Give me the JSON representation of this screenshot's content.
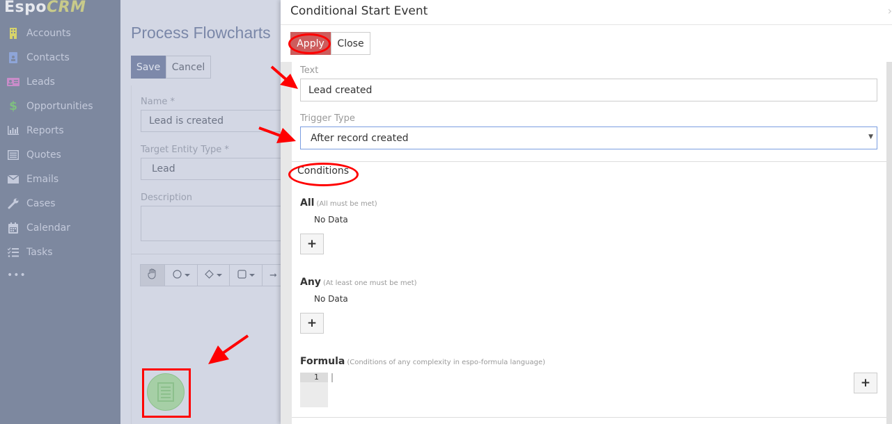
{
  "app": {
    "logo_main": "Espo",
    "logo_accent": "CRM"
  },
  "sidebar": {
    "items": [
      {
        "label": "Accounts",
        "icon": "building-icon",
        "color": "#d7d36a"
      },
      {
        "label": "Contacts",
        "icon": "id-badge-icon",
        "color": "#8ea5d8"
      },
      {
        "label": "Leads",
        "icon": "address-card-icon",
        "color": "#c98cc9"
      },
      {
        "label": "Opportunities",
        "icon": "dollar-icon",
        "color": "#7fbf7f"
      },
      {
        "label": "Reports",
        "icon": "bar-chart-icon",
        "color": "#c4cadb"
      },
      {
        "label": "Quotes",
        "icon": "list-alt-icon",
        "color": "#c4cadb"
      },
      {
        "label": "Emails",
        "icon": "envelope-icon",
        "color": "#c4cadb"
      },
      {
        "label": "Cases",
        "icon": "wrench-icon",
        "color": "#c4cadb"
      },
      {
        "label": "Calendar",
        "icon": "calendar-icon",
        "color": "#c4cadb"
      },
      {
        "label": "Tasks",
        "icon": "tasks-icon",
        "color": "#c4cadb"
      }
    ],
    "more": "•••"
  },
  "main": {
    "title": "Process Flowcharts",
    "save_label": "Save",
    "cancel_label": "Cancel",
    "fields": {
      "name_label": "Name *",
      "name_value": "Lead is created",
      "target_label": "Target Entity Type *",
      "target_value": "Lead",
      "description_label": "Description",
      "description_value": ""
    },
    "toolbar": [
      "hand-tool",
      "event-tool",
      "gateway-tool",
      "task-tool",
      "flow-tool"
    ]
  },
  "dialog": {
    "title": "Conditional Start Event",
    "apply_label": "Apply",
    "close_label": "Close",
    "text_label": "Text",
    "text_value": "Lead created",
    "trigger_label": "Trigger Type",
    "trigger_value": "After record created",
    "conditions_title": "Conditions",
    "all": {
      "title": "All",
      "hint": "(All must be met)",
      "empty": "No Data"
    },
    "any": {
      "title": "Any",
      "hint": "(At least one must be met)",
      "empty": "No Data"
    },
    "formula": {
      "title": "Formula",
      "hint": "(Conditions of any complexity in espo-formula language)",
      "line_number": "1"
    },
    "add_symbol": "+"
  },
  "colors": {
    "apply": "#cd5c5c",
    "annotation": "#ff0000",
    "sidebar_bg": "#7d889f"
  }
}
